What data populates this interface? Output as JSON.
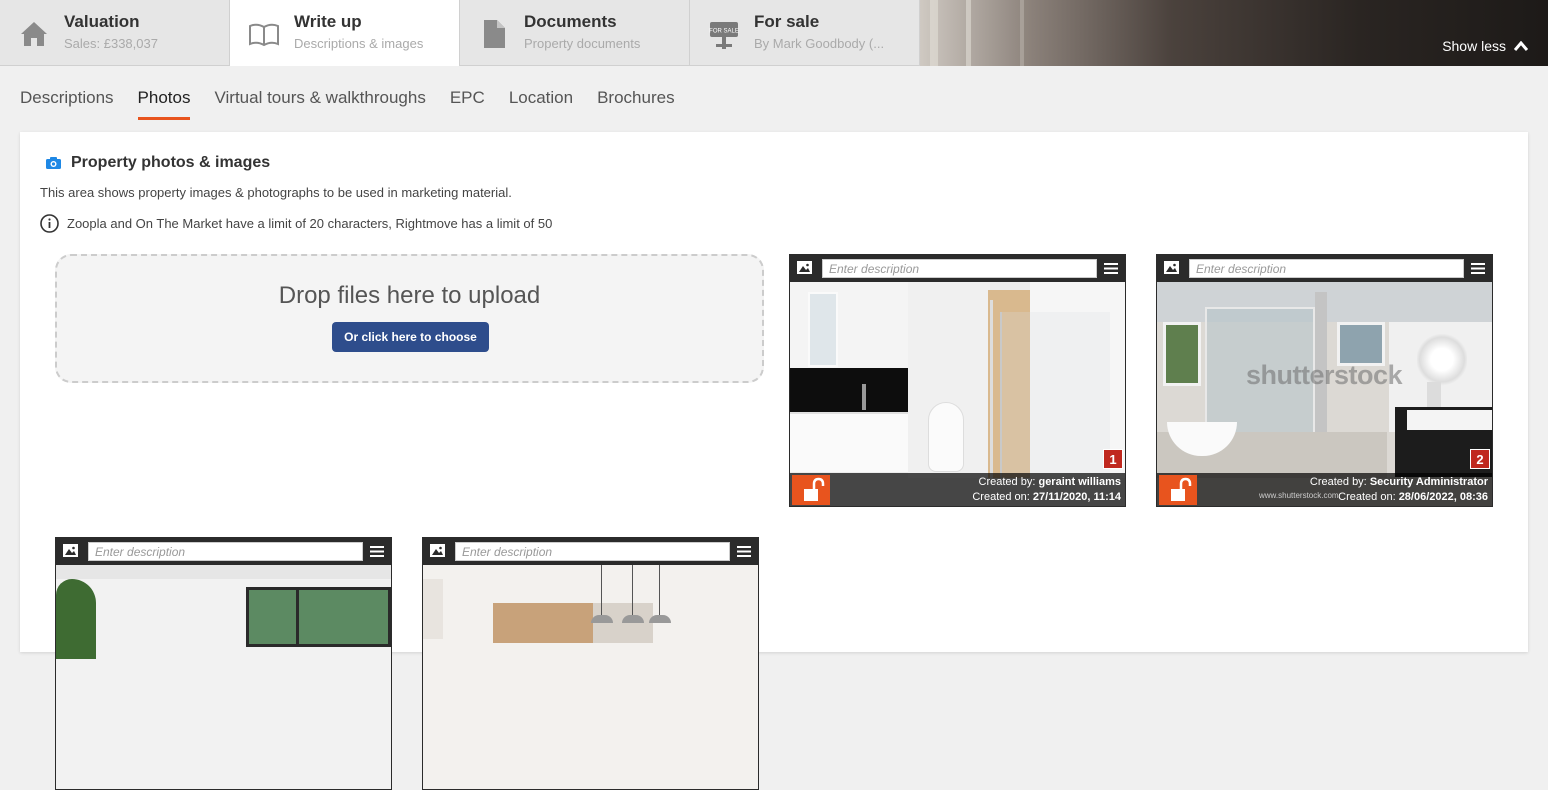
{
  "top_tabs": [
    {
      "title": "Valuation",
      "subtitle": "Sales: £338,037",
      "icon": "house-icon"
    },
    {
      "title": "Write up",
      "subtitle": "Descriptions & images",
      "icon": "book-icon"
    },
    {
      "title": "Documents",
      "subtitle": "Property documents",
      "icon": "document-icon"
    },
    {
      "title": "For sale",
      "subtitle": "By Mark Goodbody (...",
      "icon": "for-sale-sign-icon"
    }
  ],
  "for_sale_sign_text": "FOR SALE",
  "show_less": "Show less",
  "sub_tabs": [
    "Descriptions",
    "Photos",
    "Virtual tours & walkthroughs",
    "EPC",
    "Location",
    "Brochures"
  ],
  "panel": {
    "title": "Property photos & images",
    "description": "This area shows property images & photographs to be used in marketing material.",
    "info": "Zoopla and On The Market have a limit of 20 characters, Rightmove has a limit of 50"
  },
  "upload": {
    "drop_text": "Drop files here to upload",
    "button_label": "Or click here to choose"
  },
  "photos": [
    {
      "placeholder": "Enter description",
      "number": "1",
      "created_by_label": "Created by:",
      "created_by": "geraint williams",
      "created_on_label": "Created on:",
      "created_on": "27/11/2020, 11:14",
      "watermark": ""
    },
    {
      "placeholder": "Enter description",
      "number": "2",
      "created_by_label": "Created by:",
      "created_by": "Security Administrator",
      "created_on_label": "Created on:",
      "created_on": "28/06/2022, 08:36",
      "watermark": "shutterstock",
      "watermark_url": "www.shutterstock.com"
    },
    {
      "placeholder": "Enter description"
    },
    {
      "placeholder": "Enter description"
    }
  ],
  "colors": {
    "accent": "#e8541e",
    "button": "#2e4d8c",
    "badge": "#c0281e",
    "camera_icon": "#1e88e5"
  }
}
